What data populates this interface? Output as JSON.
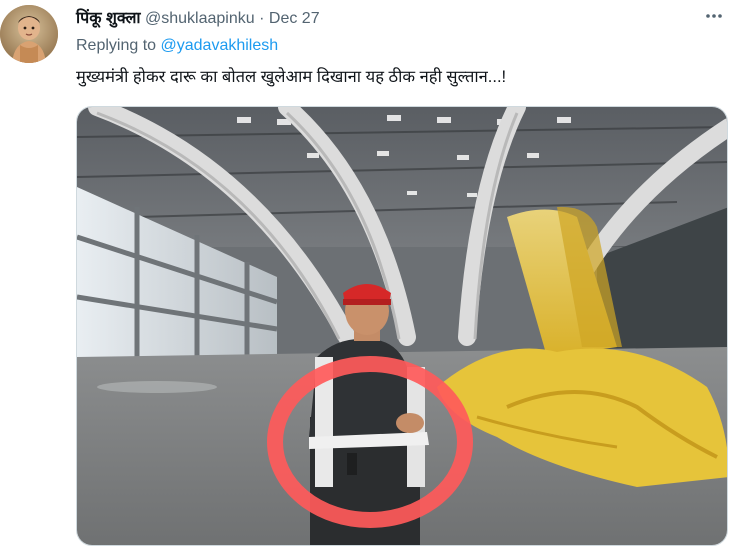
{
  "tweet": {
    "display_name": "पिंकू शुक्ला",
    "handle": "@shuklaapinku",
    "separator": "·",
    "date": "Dec 27",
    "more_icon": "ellipsis-icon",
    "replying_prefix": "Replying to",
    "replying_to": "@yadavakhilesh",
    "text": "मुख्यमंत्री होकर दारू का बोतल खुलेआम दिखाना यह ठीक नही सुल्तान...!"
  },
  "colors": {
    "text_primary": "#0f1419",
    "text_secondary": "#536471",
    "link": "#1d9bf0",
    "annotation_circle": "#ff5a5a",
    "cap_red": "#d62828",
    "tarp_yellow": "#e8c43a"
  },
  "media": {
    "kind": "photo",
    "annotation": "red-hand-drawn-circle"
  }
}
